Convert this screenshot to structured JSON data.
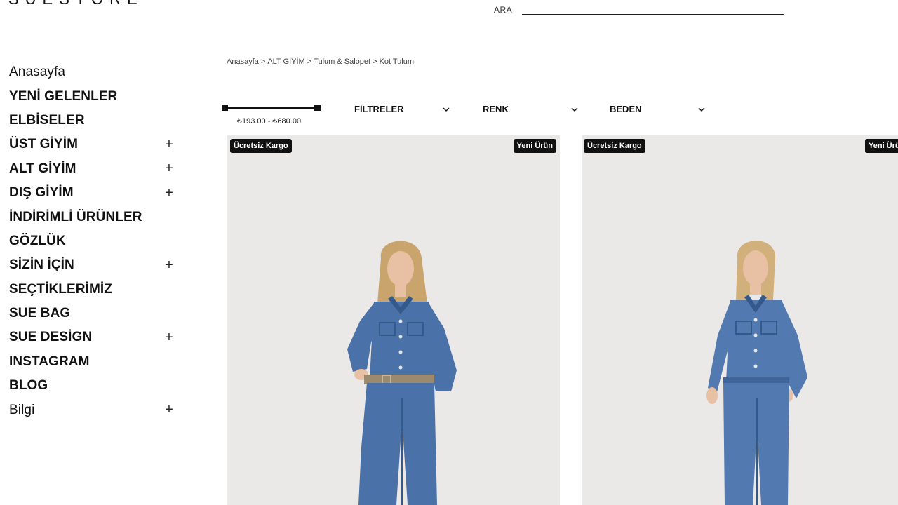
{
  "brand": {
    "logo_text": "SUESTORE"
  },
  "search": {
    "label": "ARA",
    "value": "",
    "placeholder": ""
  },
  "sidebar": {
    "items": [
      {
        "label": "Anasayfa",
        "expandable": false
      },
      {
        "label": "YENİ GELENLER",
        "expandable": false
      },
      {
        "label": "ELBİSELER",
        "expandable": false
      },
      {
        "label": "ÜST GİYİM",
        "expandable": true
      },
      {
        "label": "ALT GİYİM",
        "expandable": true
      },
      {
        "label": "DIŞ GİYİM",
        "expandable": true
      },
      {
        "label": "İNDİRİMLİ ÜRÜNLER",
        "expandable": false
      },
      {
        "label": "GÖZLÜK",
        "expandable": false
      },
      {
        "label": "SİZİN İÇİN",
        "expandable": true
      },
      {
        "label": "SEÇTİKLERİMİZ",
        "expandable": false
      },
      {
        "label": "SUE BAG",
        "expandable": false
      },
      {
        "label": "SUE DESİGN",
        "expandable": true
      },
      {
        "label": "INSTAGRAM",
        "expandable": false
      },
      {
        "label": "BLOG",
        "expandable": false
      },
      {
        "label": "Bilgi",
        "expandable": true
      }
    ],
    "expand_symbol": "+"
  },
  "breadcrumb": [
    "Anasayfa",
    "ALT GİYİM",
    "Tulum & Salopet",
    "Kot Tulum"
  ],
  "breadcrumb_separator": ">",
  "price_filter": {
    "range_text": "₺193.00 - ₺680.00",
    "min": 193.0,
    "max": 680.0
  },
  "filters": {
    "filtreler": "FİLTRELER",
    "renk": "RENK",
    "beden": "BEDEN"
  },
  "products": [
    {
      "badge_left": "Ücretsiz Kargo",
      "badge_right": "Yeni Ürün"
    },
    {
      "badge_left": "Ücretsiz Kargo",
      "badge_right": "Yeni Ürün"
    }
  ],
  "colors": {
    "photo_bg": "#ebe9e8",
    "denim": "#4a72a8",
    "denim_dark": "#345a8c",
    "badge_bg": "#111111",
    "hair": "#c9a46c",
    "skin": "#e8c0a4"
  }
}
